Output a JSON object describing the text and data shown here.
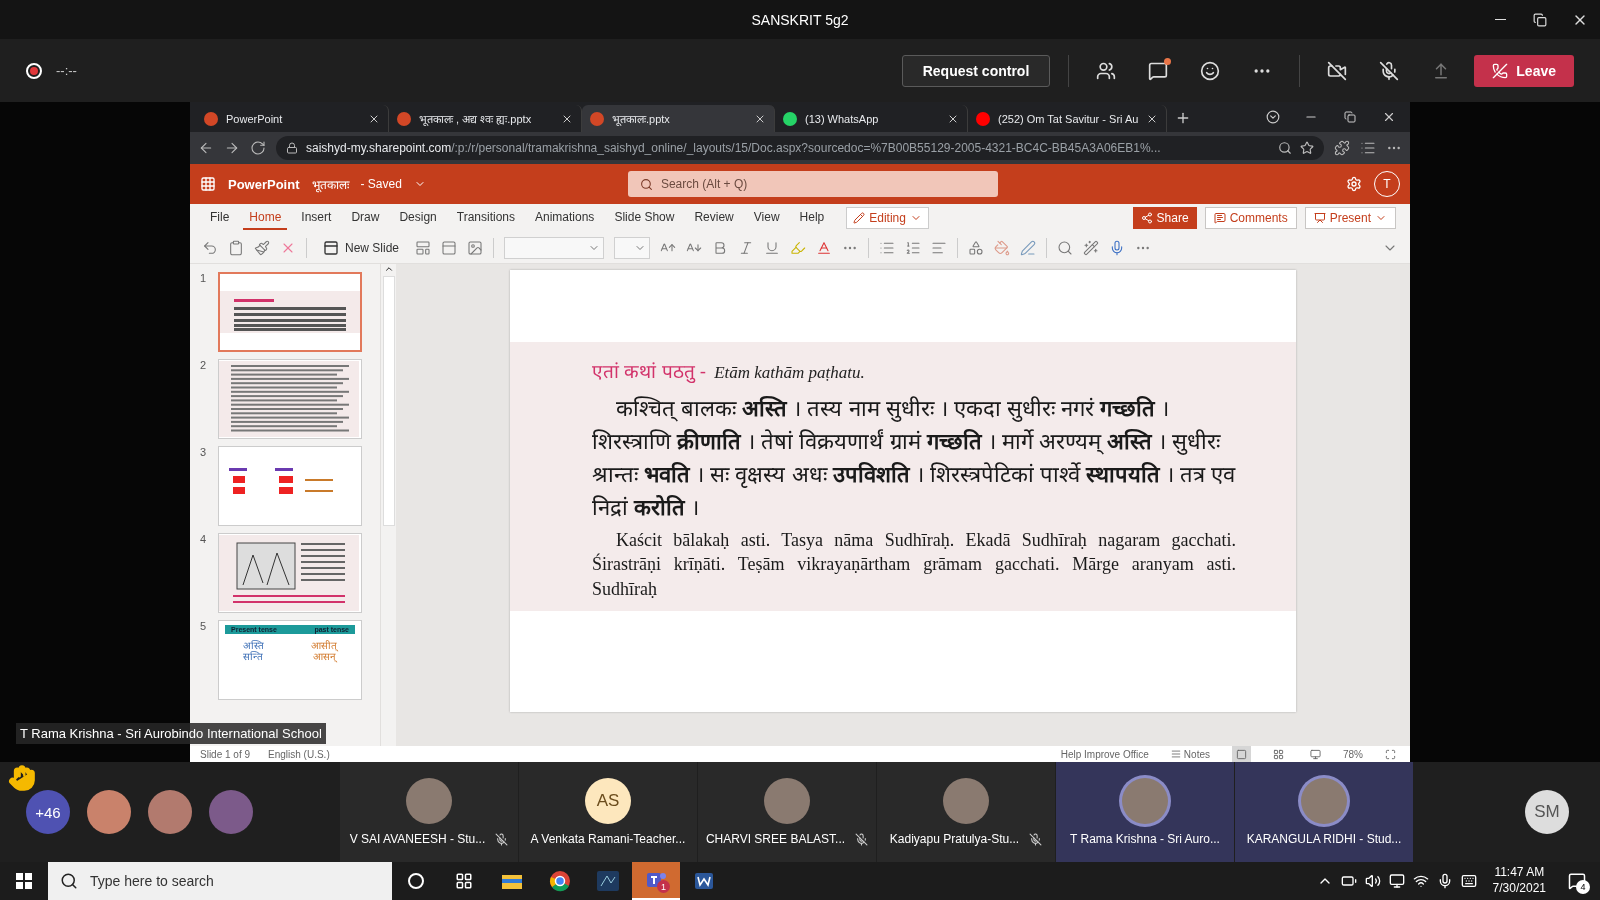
{
  "window": {
    "title": "SANSKRIT 5g2"
  },
  "meeting_bar": {
    "recording": true,
    "timer": "--:--",
    "request_control": "Request control",
    "chat_unread": true,
    "leave": "Leave"
  },
  "browser": {
    "tabs": [
      {
        "label": "PowerPoint",
        "kind": "powerpoint",
        "selected": false
      },
      {
        "label": "भूतकालः , अद्य श्वः ह्यः.pptx",
        "kind": "powerpoint",
        "selected": false
      },
      {
        "label": "भूतकालः.pptx",
        "kind": "powerpoint",
        "selected": true
      },
      {
        "label": "(13) WhatsApp",
        "kind": "whatsapp",
        "selected": false
      },
      {
        "label": "(252) Om Tat Savitur - Sri Au",
        "kind": "youtube",
        "selected": false
      }
    ],
    "url_host": "saishyd-my.sharepoint.com",
    "url_path": "/:p:/r/personal/tramakrishna_saishyd_online/_layouts/15/Doc.aspx?sourcedoc=%7B00B55129-2005-4321-BC4C-BB45A3A06EB1%..."
  },
  "powerpoint": {
    "app_name": "PowerPoint",
    "file_name": "भूतकालः",
    "save_status": "- Saved",
    "search": {
      "placeholder": "Search (Alt + Q)"
    },
    "account_initial": "T",
    "menu": [
      {
        "label": "File",
        "selected": false
      },
      {
        "label": "Home",
        "selected": true
      },
      {
        "label": "Insert",
        "selected": false
      },
      {
        "label": "Draw",
        "selected": false
      },
      {
        "label": "Design",
        "selected": false
      },
      {
        "label": "Transitions",
        "selected": false
      },
      {
        "label": "Animations",
        "selected": false
      },
      {
        "label": "Slide Show",
        "selected": false
      },
      {
        "label": "Review",
        "selected": false
      },
      {
        "label": "View",
        "selected": false
      },
      {
        "label": "Help",
        "selected": false
      }
    ],
    "mode": "Editing",
    "share": "Share",
    "comments": "Comments",
    "present": "Present",
    "new_slide": "New Slide"
  },
  "thumbnails": [
    {
      "number": "1",
      "kind": "scan",
      "selected": true
    },
    {
      "number": "2",
      "kind": "dense_scan",
      "selected": false
    },
    {
      "number": "3",
      "kind": "table",
      "selected": false
    },
    {
      "number": "4",
      "kind": "illustration",
      "selected": false
    },
    {
      "number": "5",
      "kind": "tenses",
      "selected": false,
      "columns": [
        {
          "heading": "Present tense",
          "words": [
            "अस्ति",
            "सन्ति"
          ]
        },
        {
          "heading": "past tense",
          "words": [
            "आसीत्",
            "आसन्"
          ]
        }
      ]
    }
  ],
  "slide": {
    "heading": "एतां कथां  पठतु -",
    "heading_translit": "Etām kathām paṭhatu.",
    "sanskrit": "कश्चित् बालकः  **अस्ति** । तस्य नाम सुधीरः । एकदा सुधीरः  नगरं  **गच्छति** । शिरस्त्राणि **क्रीणाति** । तेषां विक्रयणार्थं ग्रामं **गच्छति** । मार्गे अरण्यम् **अस्ति** । सुधीरः श्रान्तः **भवति** । सः वृक्षस्य अधः **उपविशति** । शिरस्त्रपेटिकां पार्श्वे **स्थापयति** । तत्र एव निद्रां **करोति** ।",
    "transliteration": "Kaścit bālakaḥ asti. Tasya nāma Sudhīraḥ. Ekadā Sudhīraḥ nagaram  gacchati. Śirastrāṇi krīṇāti. Teṣām vikrayaṇārtham  grāmam gacchati. Mārge aranyam asti. Sudhīraḥ"
  },
  "status_bar": {
    "slide_position": "Slide 1 of 9",
    "language": "English (U.S.)",
    "feedback": "Help Improve Office",
    "notes": "Notes",
    "zoom": "78%"
  },
  "presenter_label": "T Rama Krishna - Sri Aurobindo International School",
  "participants": {
    "hand_raised": true,
    "overflow_count": "+46",
    "avatars": [
      {
        "kind": "photo"
      },
      {
        "kind": "photo"
      },
      {
        "kind": "photo"
      }
    ],
    "tiles": [
      {
        "name": "V SAI AVANEESH - Stu...",
        "kind": "photo",
        "muted": true,
        "speaking": false
      },
      {
        "name": "A Venkata Ramani-Teacher...",
        "kind": "initials",
        "initials": "AS",
        "muted": false,
        "speaking": false
      },
      {
        "name": "CHARVI SREE BALAST...",
        "kind": "photo",
        "muted": true,
        "speaking": false
      },
      {
        "name": "Kadiyapu Pratulya-Stu...",
        "kind": "photo",
        "muted": true,
        "speaking": false
      },
      {
        "name": "T Rama Krishna - Sri Auro...",
        "kind": "photo",
        "muted": false,
        "speaking": true
      },
      {
        "name": "KARANGULA RIDHI - Stud...",
        "kind": "photo",
        "muted": false,
        "speaking": true
      }
    ],
    "last_initials": "SM"
  },
  "taskbar": {
    "search": {
      "placeholder": "Type here to search"
    },
    "apps": [
      {
        "kind": "cortana",
        "active": false
      },
      {
        "kind": "task_view",
        "active": false
      },
      {
        "kind": "explorer",
        "active": false
      },
      {
        "kind": "chrome",
        "active": false
      },
      {
        "kind": "terminal",
        "active": false
      },
      {
        "kind": "teams",
        "active": true,
        "badge": "1"
      },
      {
        "kind": "word",
        "active": false
      }
    ],
    "time": "11:47 AM",
    "date": "7/30/2021",
    "notifications": "4"
  }
}
